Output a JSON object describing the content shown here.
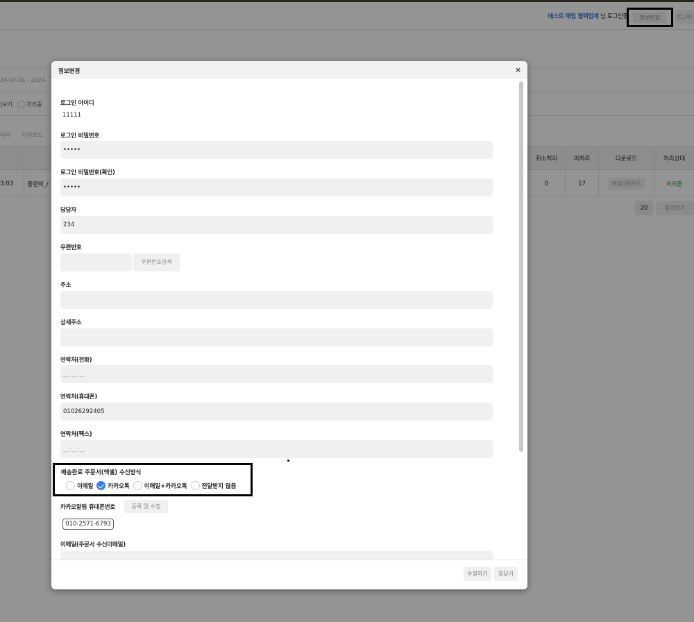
{
  "header": {
    "company": "테스트 매입 협력업체",
    "login_suffix": " 님 로그인중",
    "info_change_button": "정보변경",
    "logout_button": "로그아"
  },
  "background": {
    "date_range": "24-07-01 - 2024-",
    "view_label": "]보기",
    "status_radio_label": "처리중",
    "process_label": "처리",
    "download_label": "다운로드",
    "table": {
      "columns": [
        "취소처리",
        "미처리",
        "다운로드",
        "처리상태"
      ],
      "row": {
        "time": "3:03",
        "name": "플랜비_/",
        "cancel": "0",
        "unprocessed": "17",
        "download_button": "엑셀다운로드",
        "status": "처리중"
      }
    },
    "page_size": "20",
    "print_button": "출력보기"
  },
  "modal": {
    "title": "정보변경",
    "close_icon": "×",
    "fields": {
      "login_id_label": "로그인 아이디",
      "login_id_value": "11111",
      "password_label": "로그인 비밀번호",
      "password_value": "•••••",
      "password_confirm_label": "로그인 비밀번호(확인)",
      "password_confirm_value": "•••••",
      "manager_label": "담당자",
      "manager_value": "234",
      "zipcode_label": "우편번호",
      "zipcode_search_button": "우편번호검색",
      "address_label": "주소",
      "detail_address_label": "상세주소",
      "phone_label": "연락처(전화)",
      "phone_placeholder": "__-__-__",
      "mobile_label": "연락처(휴대폰)",
      "mobile_value": "01026292405",
      "fax_label": "연락처(팩스)",
      "fax_placeholder": "__-__-__",
      "receive_method_label": "배송완료 주문서(엑셀) 수신방식",
      "receive_options": [
        "이메일",
        "카카오톡",
        "이메일+카카오톡",
        "전달받지 않음"
      ],
      "receive_selected": "카카오톡",
      "kakao_phone_label": "카카오알림 휴대폰번호",
      "kakao_register_button": "등록 및 수정",
      "kakao_phone_value": "010-2571-6793",
      "email_label": "이메일(주문서 수신이메일)"
    },
    "footer": {
      "save_button": "수정하기",
      "close_button": "창닫기"
    }
  }
}
